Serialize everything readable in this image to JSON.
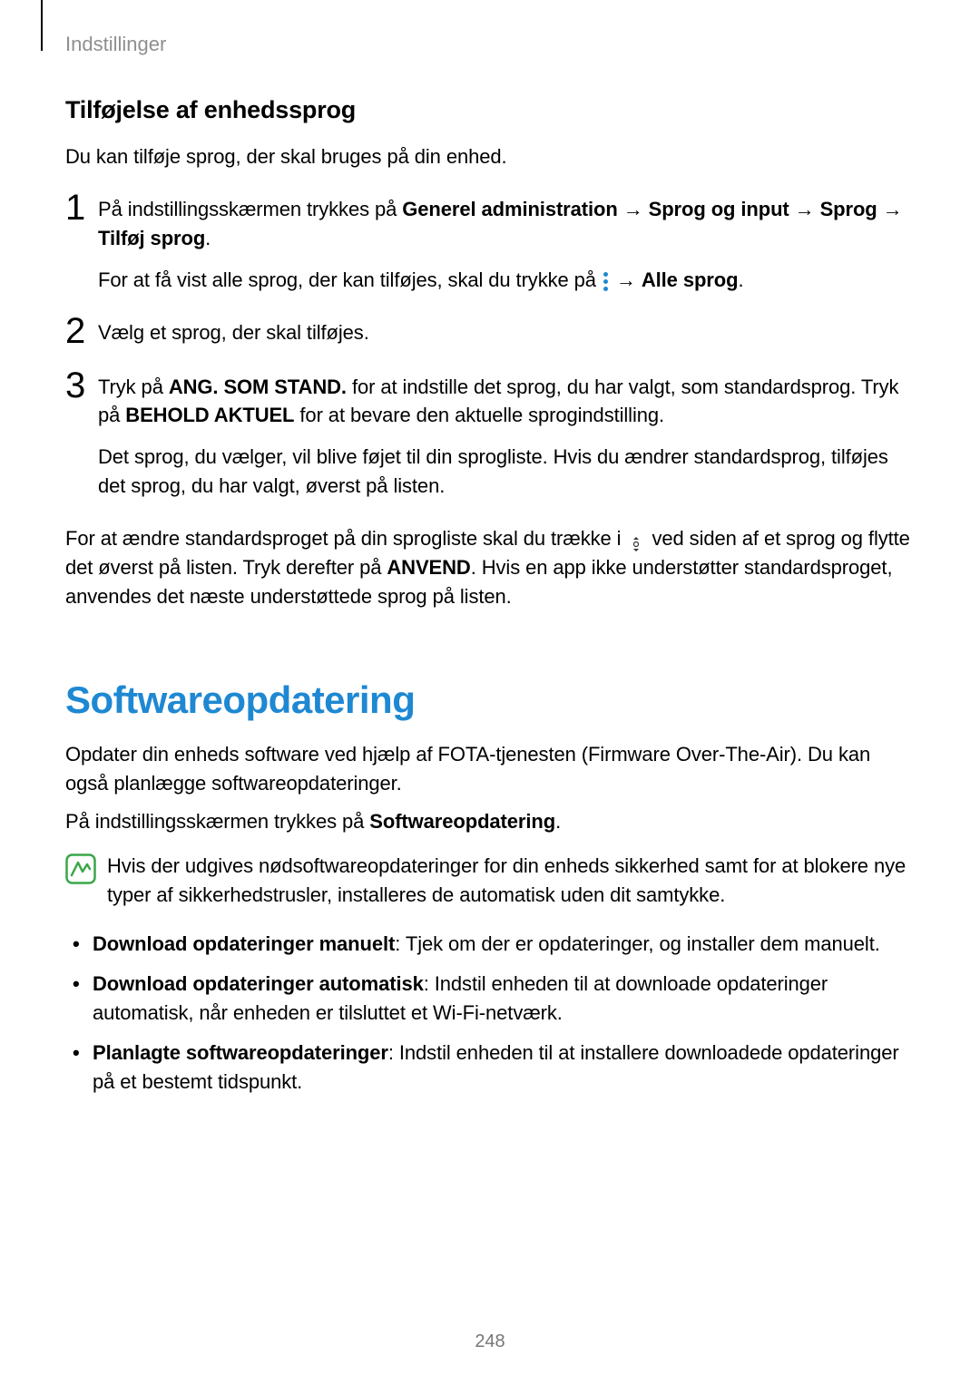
{
  "header": "Indstillinger",
  "section1": {
    "heading": "Tilføjelse af enhedssprog",
    "intro": "Du kan tilføje sprog, der skal bruges på din enhed.",
    "step1": {
      "num": "1",
      "part1_a": "På indstillingsskærmen trykkes på ",
      "bold1": "Generel administration",
      "arrow": " → ",
      "bold2": "Sprog og input",
      "bold3": "Sprog",
      "bold4": "Tilføj sprog",
      "period": ".",
      "part2_a": "For at få vist alle sprog, der kan tilføjes, skal du trykke på ",
      "bold5": "Alle sprog",
      "period2": "."
    },
    "step2": {
      "num": "2",
      "text": "Vælg et sprog, der skal tilføjes."
    },
    "step3": {
      "num": "3",
      "part1_a": "Tryk på ",
      "bold1": "ANG. SOM STAND.",
      "part1_b": " for at indstille det sprog, du har valgt, som standardsprog. Tryk på ",
      "bold2": "BEHOLD AKTUEL",
      "part1_c": " for at bevare den aktuelle sprogindstilling.",
      "part2": "Det sprog, du vælger, vil blive føjet til din sprogliste. Hvis du ændrer standardsprog, tilføjes det sprog, du har valgt, øverst på listen."
    },
    "after_a": "For at ændre standardsproget på din sprogliste skal du trække i ",
    "after_b": " ved siden af et sprog og flytte det øverst på listen. Tryk derefter på ",
    "after_bold": "ANVEND",
    "after_c": ". Hvis en app ikke understøtter standardsproget, anvendes det næste understøttede sprog på listen."
  },
  "section2": {
    "heading": "Softwareopdatering",
    "para1": "Opdater din enheds software ved hjælp af FOTA-tjenesten (Firmware Over-The-Air). Du kan også planlægge softwareopdateringer.",
    "para2_a": "På indstillingsskærmen trykkes på ",
    "para2_bold": "Softwareopdatering",
    "para2_b": ".",
    "note": "Hvis der udgives nødsoftwareopdateringer for din enheds sikkerhed samt for at blokere nye typer af sikkerhedstrusler, installeres de automatisk uden dit samtykke.",
    "bullets": {
      "b1_bold": "Download opdateringer manuelt",
      "b1_rest": ": Tjek om der er opdateringer, og installer dem manuelt.",
      "b2_bold": "Download opdateringer automatisk",
      "b2_rest": ": Indstil enheden til at downloade opdateringer automatisk, når enheden er tilsluttet et Wi-Fi-netværk.",
      "b3_bold": "Planlagte softwareopdateringer",
      "b3_rest": ": Indstil enheden til at installere downloadede opdateringer på et bestemt tidspunkt."
    }
  },
  "pageNumber": "248"
}
